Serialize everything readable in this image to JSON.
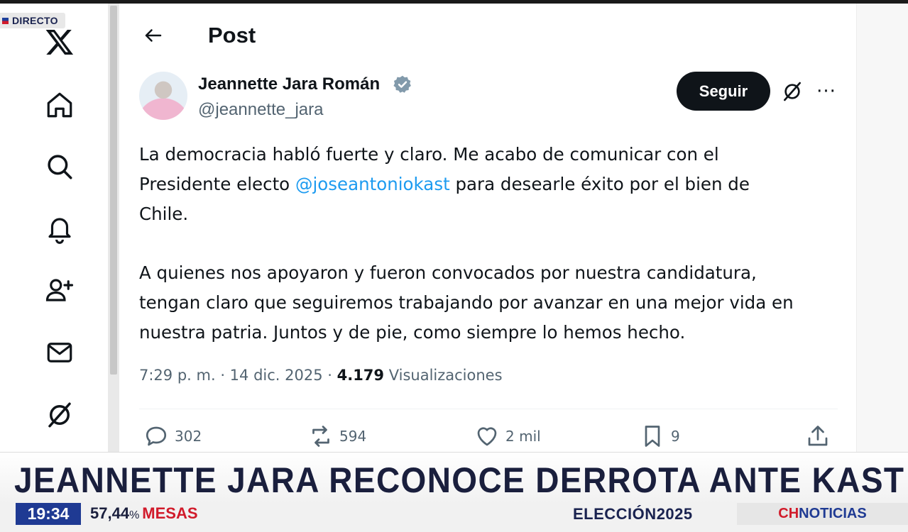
{
  "overlay": {
    "live_badge": "DIRECTO"
  },
  "nav": {
    "items": [
      {
        "name": "x-logo-icon"
      },
      {
        "name": "home-icon"
      },
      {
        "name": "search-icon"
      },
      {
        "name": "notifications-icon"
      },
      {
        "name": "follow-icon"
      },
      {
        "name": "messages-icon"
      },
      {
        "name": "grok-icon"
      }
    ]
  },
  "header": {
    "back_icon": "arrow-left-icon",
    "title": "Post"
  },
  "post": {
    "author_name": "Jeannette Jara Román",
    "handle": "@jeannette_jara",
    "follow_label": "Seguir",
    "more_label": "···",
    "text": {
      "p1_line1": "La democracia habló fuerte y claro. Me acabo de comunicar con el",
      "p1_line2_before": "Presidente electo ",
      "mention": "@joseantoniokast",
      "p1_line2_after": " para desearle éxito por el bien de",
      "p1_line3": "Chile.",
      "p2_line1": "A quienes nos apoyaron y fueron convocados por nuestra candidatura,",
      "p2_line2": "tengan claro que seguiremos trabajando por avanzar en una mejor vida en",
      "p2_line3": "nuestra patria. Juntos y de pie, como siempre lo hemos hecho."
    },
    "meta": {
      "time_date": "7:29 p. m. · 14 dic. 2025 · ",
      "views_count": "4.179",
      "views_label": " Visualizaciones"
    },
    "actions": {
      "replies": "302",
      "reposts": "594",
      "likes": "2 mil",
      "bookmarks": "9"
    }
  },
  "broadcast": {
    "headline": "JEANNETTE JARA RECONOCE DERROTA ANTE KAST",
    "clock": "19:34",
    "percent_value": "57,44",
    "percent_sign": "%",
    "percent_label": "MESAS",
    "election_word": "ELECCIÓN",
    "election_year": "2025",
    "channel_prefix": "CH",
    "channel_name": "NOTICIAS"
  },
  "colors": {
    "accent_link": "#1d9bf0",
    "follow_button": "#0f1419",
    "headline_text": "#1a1f3d",
    "clock_bg": "#1f3a93",
    "ticker_red": "#d11b2b"
  }
}
